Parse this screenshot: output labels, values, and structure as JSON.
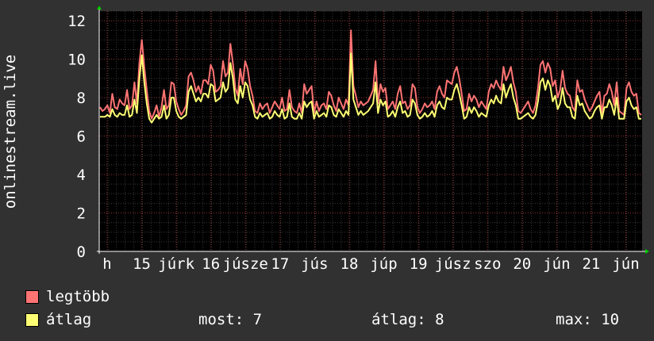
{
  "chart_data": {
    "type": "line",
    "ylabel": "onlinestream.live",
    "ylim": [
      0,
      12.5
    ],
    "yticks": [
      0,
      2,
      4,
      6,
      8,
      10,
      12
    ],
    "xticks": [
      "h",
      "15",
      "júrk",
      "16",
      "júsze",
      "17",
      "jús",
      "18",
      "júp",
      "19",
      "júsz",
      "szo",
      "20",
      "jún",
      "21",
      "jún"
    ],
    "grid": true,
    "series": [
      {
        "name": "legtöbb",
        "color": "#ff7373",
        "values": [
          7.5,
          7.3,
          7.4,
          7.6,
          7.2,
          8.2,
          7.5,
          7.4,
          7.9,
          7.7,
          7.6,
          8.4,
          7.4,
          7.6,
          8.8,
          7.7,
          9.8,
          11,
          9.6,
          8.4,
          7.3,
          6.9,
          7.2,
          7.6,
          7.0,
          7.5,
          8.4,
          7.4,
          7.6,
          8.8,
          8.7,
          7.8,
          7.4,
          7.1,
          7.3,
          7.6,
          9.1,
          9.3,
          8.9,
          8.3,
          8.6,
          8.2,
          8.9,
          8.9,
          8.7,
          9.7,
          9.4,
          8.3,
          8.4,
          8.6,
          9.9,
          9.1,
          9.3,
          10.8,
          9.8,
          8.5,
          8.1,
          9.5,
          8.7,
          9.9,
          9.5,
          8.6,
          8.1,
          7.3,
          7.2,
          7.7,
          7.4,
          7.6,
          7.7,
          7.2,
          7.5,
          7.8,
          7.6,
          7.4,
          8.0,
          7.3,
          7.4,
          8.4,
          7.5,
          7.3,
          7.2,
          7.7,
          7.2,
          8.7,
          8.2,
          8.4,
          8.6,
          7.2,
          7.8,
          7.3,
          7.6,
          7.7,
          7.4,
          8.3,
          8.1,
          7.6,
          7.3,
          8.0,
          7.7,
          7.4,
          7.9,
          7.6,
          11.5,
          8.6,
          8.1,
          7.5,
          7.8,
          7.6,
          7.7,
          7.8,
          8.1,
          8.4,
          9.9,
          7.7,
          8.7,
          8.3,
          8.5,
          7.4,
          7.6,
          7.8,
          7.4,
          8.2,
          8.6,
          7.7,
          7.8,
          7.4,
          7.6,
          8.7,
          8.5,
          7.5,
          7.2,
          7.4,
          7.7,
          7.5,
          7.6,
          7.8,
          7.4,
          8.3,
          8.6,
          8.2,
          8.0,
          8.9,
          8.8,
          8.7,
          9.3,
          9.6,
          9.0,
          8.2,
          7.3,
          7.4,
          8.2,
          7.8,
          8.1,
          7.9,
          7.5,
          7.8,
          7.6,
          7.4,
          8.3,
          8.7,
          8.5,
          8.9,
          8.6,
          8.4,
          9.6,
          8.9,
          9.2,
          9.6,
          8.8,
          8.3,
          7.3,
          7.2,
          7.4,
          7.6,
          7.8,
          7.4,
          7.2,
          7.6,
          8.5,
          9.7,
          9.9,
          9.3,
          9.8,
          9.5,
          8.6,
          8.9,
          8.0,
          8.4,
          9.4,
          8.5,
          8.2,
          8.1,
          7.5,
          7.3,
          8.9,
          8.3,
          8.4,
          7.9,
          7.6,
          7.3,
          7.5,
          7.8,
          8.1,
          8.3,
          7.2,
          8.1,
          8.2,
          8.7,
          8.3,
          7.6,
          8.8,
          7.3,
          7.2,
          7.1,
          8.5,
          8.8,
          8.3,
          8.1,
          8.2,
          7.2,
          7.1
        ]
      },
      {
        "name": "átlag",
        "color": "#ffff73",
        "values": [
          7.0,
          7.0,
          7.0,
          7.1,
          7.0,
          7.4,
          7.1,
          7.0,
          7.2,
          7.1,
          7.1,
          7.6,
          7.0,
          7.1,
          7.9,
          7.2,
          9.0,
          10.2,
          8.8,
          7.7,
          6.9,
          6.7,
          6.9,
          7.1,
          6.9,
          7.0,
          7.6,
          6.9,
          7.1,
          8.0,
          8.0,
          7.3,
          7.0,
          6.9,
          7.0,
          7.1,
          8.3,
          8.6,
          8.2,
          7.8,
          8.0,
          7.8,
          8.2,
          8.2,
          8.0,
          8.7,
          8.6,
          7.8,
          7.9,
          8.0,
          8.8,
          8.3,
          8.5,
          9.8,
          9.0,
          7.9,
          7.7,
          8.6,
          8.0,
          8.8,
          8.6,
          7.9,
          7.6,
          7.0,
          6.9,
          7.2,
          7.0,
          7.1,
          7.2,
          6.9,
          7.0,
          7.3,
          7.1,
          7.0,
          7.4,
          6.9,
          7.0,
          7.7,
          7.0,
          6.9,
          6.9,
          7.2,
          6.9,
          7.8,
          7.5,
          7.7,
          7.8,
          6.9,
          7.3,
          7.0,
          7.1,
          7.2,
          7.0,
          7.6,
          7.5,
          7.1,
          7.0,
          7.4,
          7.2,
          7.0,
          7.3,
          7.1,
          10.3,
          7.9,
          7.5,
          7.1,
          7.3,
          7.1,
          7.2,
          7.3,
          7.5,
          7.7,
          8.8,
          7.2,
          7.9,
          7.6,
          7.8,
          7.0,
          7.1,
          7.3,
          7.0,
          7.5,
          7.8,
          7.2,
          7.3,
          7.0,
          7.1,
          7.9,
          7.7,
          7.1,
          6.9,
          7.0,
          7.2,
          7.0,
          7.1,
          7.3,
          7.0,
          7.6,
          7.8,
          7.5,
          7.4,
          8.0,
          7.9,
          7.9,
          8.4,
          8.7,
          8.2,
          7.6,
          6.9,
          7.0,
          7.5,
          7.2,
          7.5,
          7.3,
          7.0,
          7.2,
          7.1,
          7.0,
          7.6,
          7.9,
          7.7,
          8.1,
          7.8,
          7.7,
          8.7,
          8.0,
          8.4,
          8.7,
          8.0,
          7.6,
          6.9,
          6.9,
          7.0,
          7.1,
          7.2,
          7.0,
          6.9,
          7.1,
          7.8,
          8.8,
          9.0,
          8.4,
          8.9,
          8.6,
          7.8,
          8.1,
          7.4,
          7.7,
          8.5,
          7.7,
          7.5,
          7.5,
          7.0,
          6.9,
          8.1,
          7.6,
          7.7,
          7.3,
          7.1,
          6.9,
          7.0,
          7.3,
          7.5,
          7.6,
          6.9,
          7.5,
          7.5,
          7.9,
          7.6,
          7.1,
          8.0,
          6.9,
          6.9,
          6.9,
          7.8,
          8.0,
          7.6,
          7.4,
          7.5,
          6.9,
          6.9
        ]
      }
    ]
  },
  "legend": {
    "max_label": "legtöbb",
    "avg_label": "átlag",
    "now": "most: 7",
    "avg": "átlag: 8",
    "max": "max: 10"
  },
  "colors": {
    "background": "#313131",
    "plot_background": "#000000",
    "grid_major": "#8a2f2f",
    "grid_minor": "#3a3a3a",
    "axis_arrow": "#00cc00"
  }
}
